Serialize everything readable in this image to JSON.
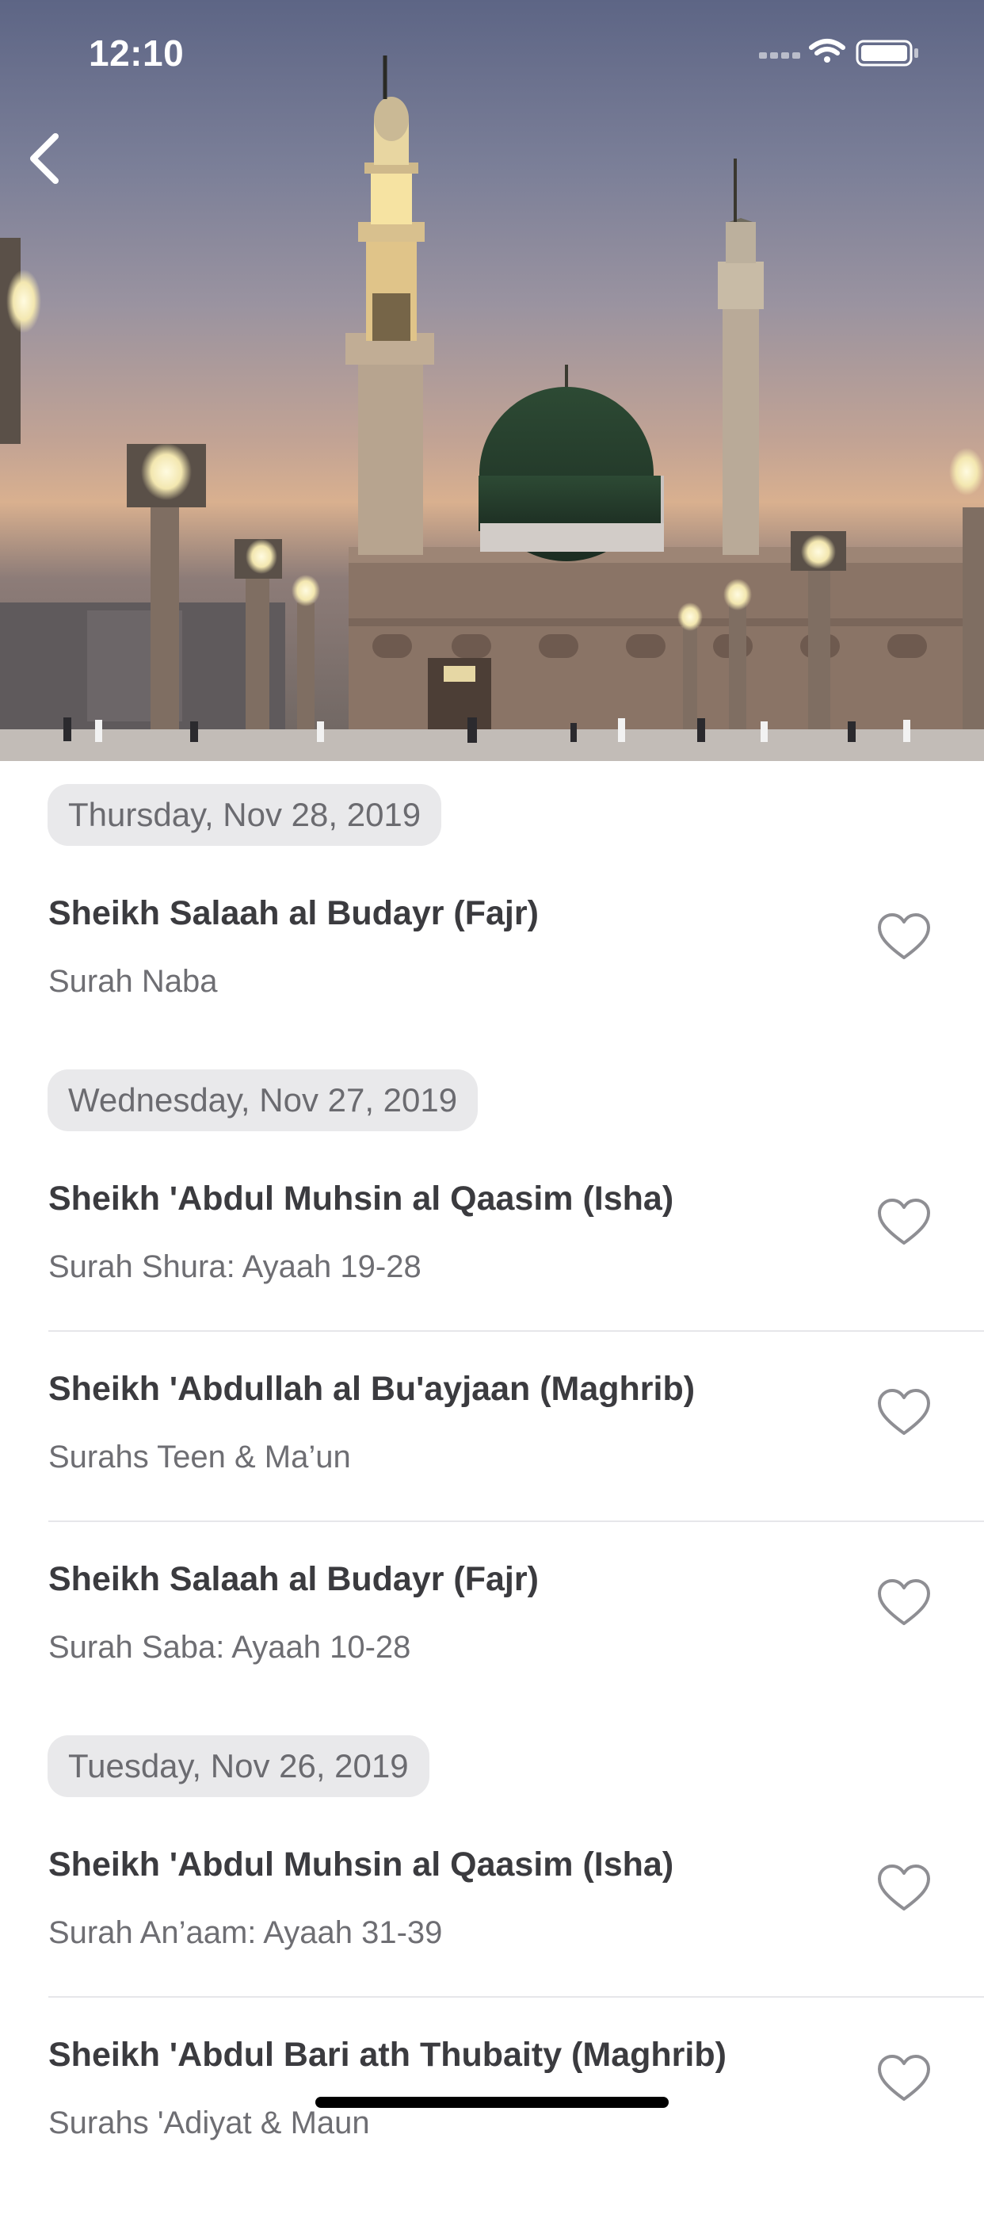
{
  "status_bar": {
    "time": "12:10"
  },
  "colors": {
    "background": "#ffffff",
    "pill_bg": "#e9e9eb",
    "title": "#3b3b3f",
    "subtitle": "#6e6e73",
    "heart": "#8e8e93"
  },
  "sections": [
    {
      "date": "Thursday, Nov 28, 2019",
      "items": [
        {
          "title": "Sheikh Salaah al Budayr (Fajr)",
          "subtitle": "Surah Naba"
        }
      ]
    },
    {
      "date": "Wednesday, Nov 27, 2019",
      "items": [
        {
          "title": "Sheikh 'Abdul Muhsin al Qaasim (Isha)",
          "subtitle": "Surah Shura: Ayaah 19-28"
        },
        {
          "title": "Sheikh 'Abdullah al Bu'ayjaan (Maghrib)",
          "subtitle": "Surahs Teen & Ma’un"
        },
        {
          "title": "Sheikh Salaah al Budayr (Fajr)",
          "subtitle": "Surah Saba: Ayaah 10-28"
        }
      ]
    },
    {
      "date": "Tuesday, Nov 26, 2019",
      "items": [
        {
          "title": "Sheikh 'Abdul Muhsin al Qaasim (Isha)",
          "subtitle": "Surah An’aam: Ayaah 31-39"
        },
        {
          "title": "Sheikh 'Abdul Bari ath Thubaity (Maghrib)",
          "subtitle": "Surahs 'Adiyat & Maun"
        }
      ]
    }
  ]
}
